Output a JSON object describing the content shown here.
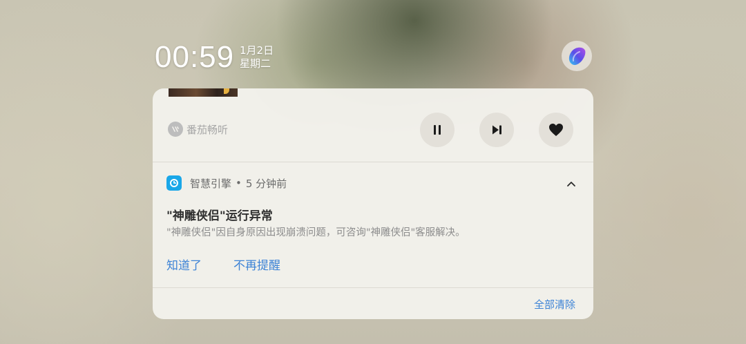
{
  "status": {
    "time": "00:59",
    "date": "1月2日",
    "weekday": "星期二"
  },
  "media": {
    "app_name": "番茄畅听",
    "app_icon": "tomato-listen-logo-icon",
    "controls": [
      "pause-icon",
      "skip-next-icon",
      "heart-icon"
    ]
  },
  "notification": {
    "app_name": "智慧引擎",
    "separator": "•",
    "time_ago": "5 分钟前",
    "app_icon": "smart-engine-icon",
    "title": "\"神雕侠侣\"运行异常",
    "body": "\"神雕侠侣\"因自身原因出现崩溃问题，可咨询\"神雕侠侣\"客服解决。",
    "actions": {
      "acknowledge": "知道了",
      "dont_remind": "不再提醒"
    }
  },
  "panel": {
    "clear_all": "全部清除"
  },
  "colors": {
    "accent": "#3d83d6",
    "notif_icon": "#1aa7e8"
  }
}
